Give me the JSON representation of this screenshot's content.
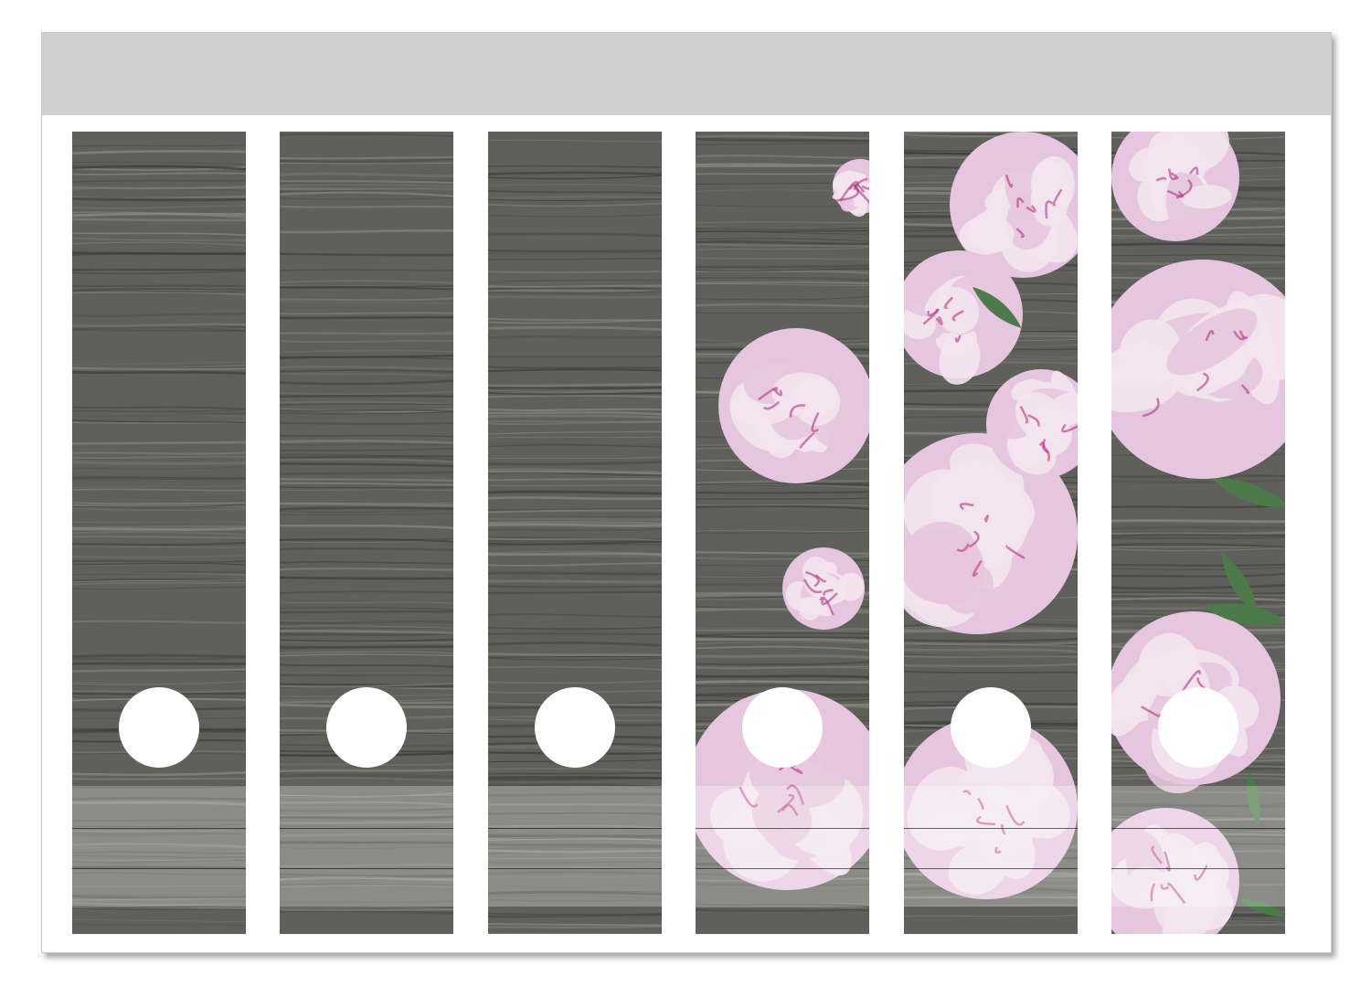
{
  "sheet": {
    "colors": {
      "header_strip": "#cfcfcf",
      "wood_base": "#5f5f5b",
      "wood_dark": "#3d3d3a",
      "wood_light": "#8a8883",
      "peony_pink": "#e6c6de",
      "peony_light": "#f3e4ef",
      "peony_magenta": "#b0357f",
      "leaf_green": "#4d7a4a"
    },
    "spines": [
      {
        "motif": "wood-grain"
      },
      {
        "motif": "wood-grain"
      },
      {
        "motif": "wood-grain"
      },
      {
        "motif": "wood-with-peonies"
      },
      {
        "motif": "peonies"
      },
      {
        "motif": "peonies-with-leaves"
      }
    ]
  }
}
